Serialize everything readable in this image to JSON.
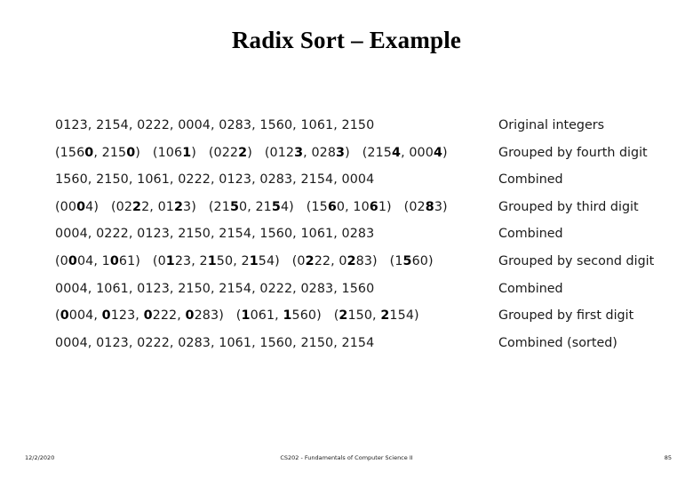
{
  "slide": {
    "title": "Radix Sort – Example",
    "rows": [
      {
        "sequence_html": "0123, 2154, 0222, 0004, 0283, 1560, 1061, 2150",
        "sequence_text": "0123, 2154, 0222, 0004, 0283, 1560, 1061, 2150",
        "label": "Original integers"
      },
      {
        "sequence_html": "(156<b>0</b>, 215<b>0</b>)&nbsp;&nbsp; (106<b>1</b>)&nbsp;&nbsp; (022<b>2</b>)&nbsp;&nbsp; (012<b>3</b>, 028<b>3</b>)&nbsp;&nbsp; (215<b>4</b>, 000<b>4</b>)",
        "sequence_text": "(1560, 2150)  (1061)  (0222)  (0123, 0283)  (2154, 0004)",
        "label": "Grouped by fourth digit"
      },
      {
        "sequence_html": "1560, 2150, 1061, 0222, 0123, 0283, 2154, 0004",
        "sequence_text": "1560, 2150, 1061, 0222, 0123, 0283, 2154, 0004",
        "label": "Combined"
      },
      {
        "sequence_html": "(00<b>0</b>4)&nbsp;&nbsp; (02<b>2</b>2, 01<b>2</b>3)&nbsp;&nbsp; (21<b>5</b>0, 21<b>5</b>4)&nbsp;&nbsp; (15<b>6</b>0, 10<b>6</b>1)&nbsp;&nbsp; (02<b>8</b>3)",
        "sequence_text": "(0004)  (0222, 0123)  (2150, 2154)  (1560, 1061)  (0283)",
        "label": "Grouped by third digit"
      },
      {
        "sequence_html": "0004, 0222, 0123, 2150, 2154, 1560, 1061, 0283",
        "sequence_text": "0004, 0222, 0123, 2150, 2154, 1560, 1061, 0283",
        "label": "Combined"
      },
      {
        "sequence_html": "(0<b>0</b>04, 1<b>0</b>61)&nbsp;&nbsp; (0<b>1</b>23, 2<b>1</b>50, 2<b>1</b>54)&nbsp;&nbsp; (0<b>2</b>22, 0<b>2</b>83)&nbsp;&nbsp; (1<b>5</b>60)",
        "sequence_text": "(0004, 1061)  (0123, 2150, 2154)  (0222, 0283)  (1560)",
        "label": "Grouped by second digit"
      },
      {
        "sequence_html": "0004, 1061, 0123, 2150, 2154, 0222, 0283, 1560",
        "sequence_text": "0004, 1061, 0123, 2150, 2154, 0222, 0283, 1560",
        "label": "Combined"
      },
      {
        "sequence_html": "(<b>0</b>004, <b>0</b>123, <b>0</b>222, <b>0</b>283)&nbsp;&nbsp; (<b>1</b>061, <b>1</b>560)&nbsp;&nbsp; (<b>2</b>150, <b>2</b>154)",
        "sequence_text": "(0004, 0123, 0222, 0283)  (1061, 1560)  (2150, 2154)",
        "label": "Grouped by first digit"
      },
      {
        "sequence_html": "0004, 0123, 0222, 0283, 1061, 1560, 2150, 2154",
        "sequence_text": "0004, 0123, 0222, 0283, 1061, 1560, 2150, 2154",
        "label": "Combined (sorted)"
      }
    ]
  },
  "footer": {
    "date": "12/2/2020",
    "course": "CS202 - Fundamentals of Computer Science II",
    "page_number": "85"
  }
}
